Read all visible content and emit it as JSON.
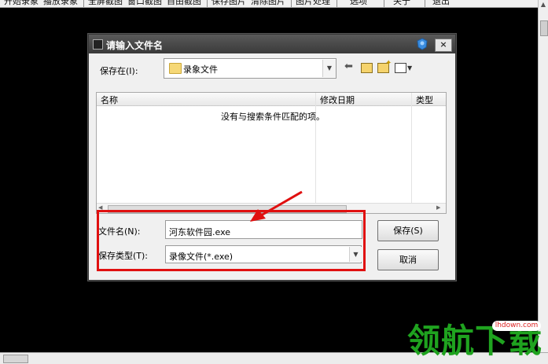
{
  "toolbar": {
    "buttons": [
      "开始录象",
      "播放录象",
      "全屏截图",
      "窗口截图",
      "自由截图",
      "保存图片",
      "清除图片",
      "图片处理",
      "选项",
      "关于",
      "退出"
    ]
  },
  "dialog": {
    "title": "请输入文件名",
    "close_label": "×",
    "save_in_label": "保存在(I):",
    "save_in_value": "录象文件",
    "columns": [
      "名称",
      "修改日期",
      "类型"
    ],
    "empty_message": "没有与搜索条件匹配的项。",
    "filename_label": "文件名(N):",
    "filename_value": "河东软件园.exe",
    "filetype_label": "保存类型(T):",
    "filetype_value": "录像文件(*.exe)",
    "save_button": "保存(S)",
    "cancel_button": "取消"
  },
  "icons": {
    "close": "close-icon",
    "help": "help-icon",
    "back": "back-arrow-icon",
    "up": "up-folder-icon",
    "new_folder": "new-folder-icon",
    "view": "view-menu-icon"
  },
  "colors": {
    "annotation_red": "#e01010",
    "watermark_green": "#1fa31f"
  },
  "watermark": {
    "logo": "领航下载",
    "url": "lhdown.com"
  }
}
